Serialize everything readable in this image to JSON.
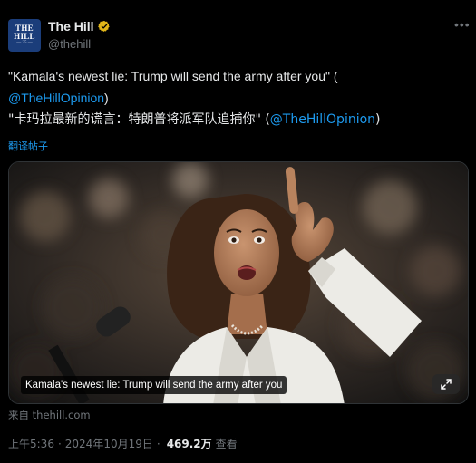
{
  "account": {
    "display_name": "The Hill",
    "handle": "@thehill",
    "avatar_line1": "THE",
    "avatar_line2": "HILL",
    "avatar_line3": "— 25 —"
  },
  "tweet": {
    "line1_text": "\"Kamala's newest lie: Trump will send the army after you\" (",
    "line1_mention": "@TheHillOpinion",
    "line1_close": ")",
    "line2_text": "\"卡玛拉最新的谎言：特朗普将派军队追捕你\" (",
    "line2_mention": "@TheHillOpinion",
    "line2_close": ")",
    "translate_label": "翻译帖子"
  },
  "media": {
    "caption": "Kamala's newest lie: Trump will send the army after you"
  },
  "source": "来自 thehill.com",
  "meta": {
    "time": "上午5:36",
    "date": "2024年10月19日",
    "views": "469.2万",
    "views_label": "查看"
  },
  "colors": {
    "background": "#000000",
    "link": "#1d9bf0",
    "muted": "#71767b",
    "verified": "#e2b719"
  },
  "icons": {
    "verified": "verified-badge-icon",
    "more": "more-icon",
    "expand": "expand-icon"
  }
}
